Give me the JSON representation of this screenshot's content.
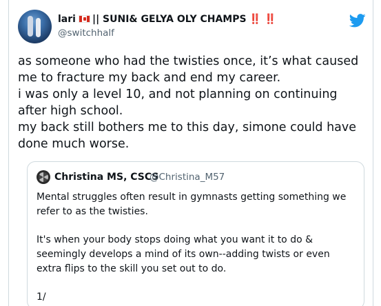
{
  "tweet": {
    "author": {
      "name_prefix": "lari",
      "name_main": "|| SUNI& GELYA OLY CHAMPS",
      "name_suffix": "‼️ ‼️",
      "handle": "@switchhalf"
    },
    "text": "as someone who had the twisties once, it’s what caused me to fracture my back and end my career.\ni was only a level 10, and not planning on continuing after high school.\nmy back still bothers me to this day, simone could have done much worse."
  },
  "quoted_tweet": {
    "author_name": "Christina MS, CSCS",
    "author_handle": "@Christina_M57",
    "paragraphs": [
      "Mental struggles often result in gymnasts getting something we refer to as the twisties.",
      "It's when your body stops doing what you want it to do & seemingly develops a mind of its own--adding twists or even extra flips to the skill you set out to do.",
      "1/"
    ]
  },
  "icons": {
    "brand": "twitter-bird-icon",
    "flag": "canada-flag-icon"
  },
  "colors": {
    "brand_blue": "#1d9bf0",
    "text_primary": "#0f1419",
    "text_secondary": "#536471",
    "border": "#cfd9de",
    "emoji_red": "#e0245e"
  }
}
